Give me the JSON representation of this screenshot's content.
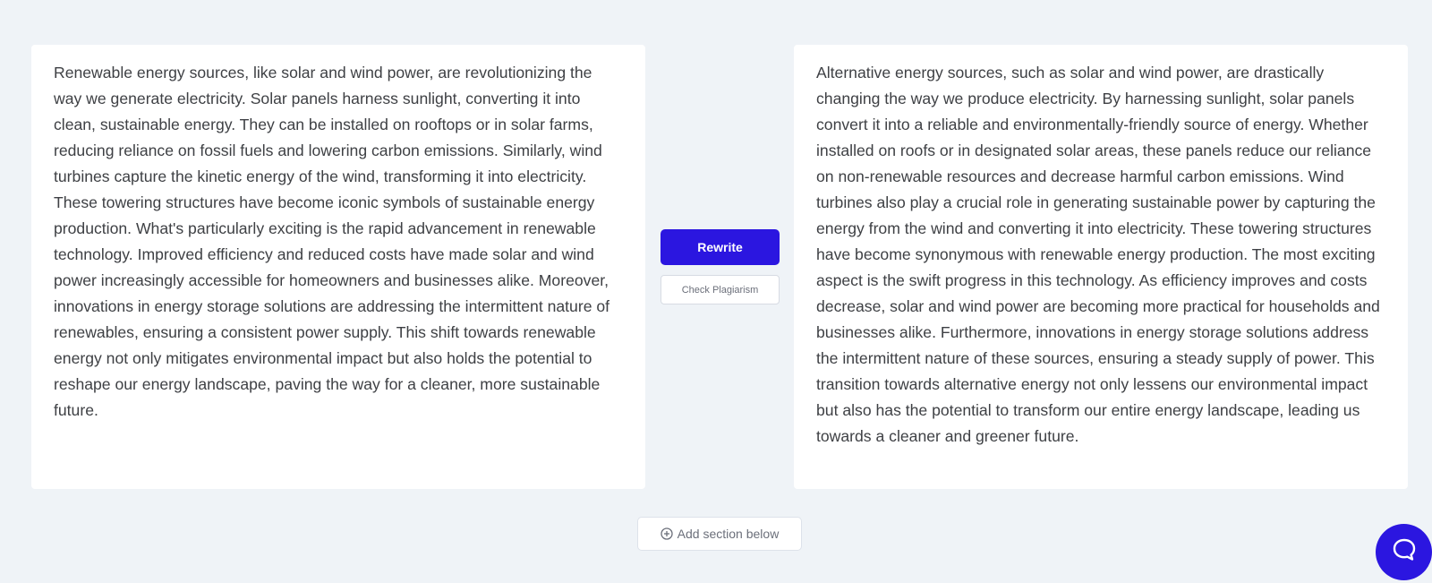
{
  "original": {
    "text": "Renewable energy sources, like solar and wind power, are revolutionizing the way we generate electricity. Solar panels harness sunlight, converting it into clean, sustainable energy. They can be installed on rooftops or in solar farms, reducing reliance on fossil fuels and lowering carbon emissions. Similarly, wind turbines capture the kinetic energy of the wind, transforming it into electricity. These towering structures have become iconic symbols of sustainable energy production. What's particularly exciting is the rapid advancement in renewable technology. Improved efficiency and reduced costs have made solar and wind power increasingly accessible for homeowners and businesses alike. Moreover, innovations in energy storage solutions are addressing the intermittent nature of renewables, ensuring a consistent power supply. This shift towards renewable energy not only mitigates environmental impact but also holds the potential to reshape our energy landscape, paving the way for a cleaner, more sustainable future."
  },
  "rewritten": {
    "text": "Alternative energy sources, such as solar and wind power, are drastically changing the way we produce electricity. By harnessing sunlight, solar panels convert it into a reliable and environmentally-friendly source of energy. Whether installed on roofs or in designated solar areas, these panels reduce our reliance on non-renewable resources and decrease harmful carbon emissions. Wind turbines also play a crucial role in generating sustainable power by capturing the energy from the wind and converting it into electricity. These towering structures have become synonymous with renewable energy production. The most exciting aspect is the swift progress in this technology. As efficiency improves and costs decrease, solar and wind power are becoming more practical for households and businesses alike. Furthermore, innovations in energy storage solutions address the intermittent nature of these sources, ensuring a steady supply of power. This transition towards alternative energy not only lessens our environmental impact but also has the potential to transform our entire energy landscape, leading us towards a cleaner and greener future."
  },
  "actions": {
    "rewrite_label": "Rewrite",
    "check_plagiarism_label": "Check Plagiarism"
  },
  "footer": {
    "add_section_label": "Add section below",
    "add_section_icon": "circle-plus-icon",
    "chat_icon": "chat-bubble-icon"
  },
  "colors": {
    "accent": "#2b16e0",
    "background": "#eff3f7",
    "panel": "#ffffff",
    "text": "#3e4044"
  }
}
